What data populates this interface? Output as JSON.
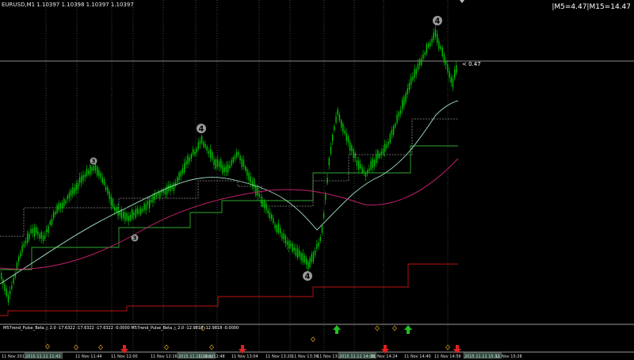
{
  "header": {
    "symbol_line": "EURUSD,M1  1.10397 1.10398 1.10397 1.10397",
    "readout": "|M5=4.47|M15=14.47"
  },
  "price_label": "< 0.47",
  "indicator_label": "M57rend_Pulse_Beta △ 2.0 -17.6322 -17.6322 -17.6322 -0.0000  M57rend_Pulse_Beta △ 2.0 -12.9818 -12.9818 -0.0000",
  "wave_labels": [
    "3",
    "3",
    "4",
    "4",
    "4"
  ],
  "time_axis": [
    "11 Nov 2015",
    "2015.11.11 11:43",
    "11 Nov 11:44",
    "11 Nov 12:00",
    "11 Nov 12:16",
    "2015.11.11 12:32",
    "11 Nov 12:48",
    "11 Nov 13:04",
    "11 Nov 13:20",
    "11 Nov 13:36",
    "11 Nov 13:52",
    "2015.11.11 14:08",
    "11 Nov 14:24",
    "11 Nov 14:40",
    "11 Nov 14:56",
    "2015.11.11 15:12",
    "11 Nov 15:28"
  ],
  "colors": {
    "background": "#000000",
    "candles": "#00d000",
    "grid": "#555555",
    "ma_fast": "#a0e0c0",
    "ma_slow": "#c0206a",
    "steps_green": "#2fa82f",
    "steps_red": "#c01010",
    "arrow_up": "#20c020",
    "arrow_down": "#e02020",
    "diamond": "#d0a020"
  }
}
